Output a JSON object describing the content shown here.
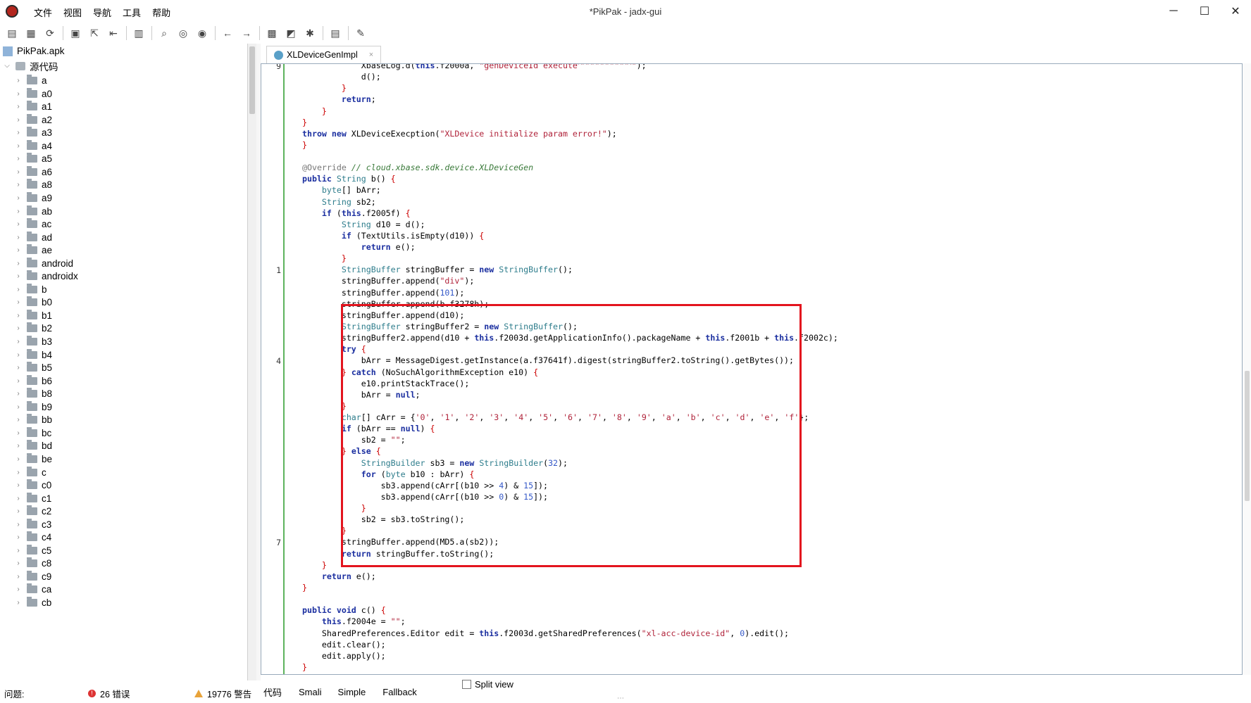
{
  "window": {
    "title": "*PikPak - jadx-gui",
    "menu": [
      "文件",
      "视图",
      "导航",
      "工具",
      "帮助"
    ],
    "controls": {
      "minimize": "─",
      "maximize": "☐",
      "close": "✕"
    }
  },
  "toolbar": {
    "icons": [
      "open-file-icon",
      "add-file-icon",
      "reload-icon",
      "save-icon",
      "export-icon",
      "sync-tree-icon",
      "flatten-icon",
      "search-icon",
      "search-class-icon",
      "search-usage-icon",
      "back-icon",
      "forward-icon",
      "quark-icon",
      "deobfuscation-icon",
      "debug-icon",
      "log-icon",
      "preferences-icon"
    ],
    "glyphs": [
      "▤",
      "▦",
      "⟳",
      "▣",
      "⇱",
      "⇤",
      "▥",
      "⌕",
      "◎",
      "◉",
      "←",
      "→",
      "▩",
      "◩",
      "✱",
      "▤",
      "✎"
    ]
  },
  "tree": {
    "root": "PikPak.apk",
    "source_node": "源代码",
    "packages": [
      "a",
      "a0",
      "a1",
      "a2",
      "a3",
      "a4",
      "a5",
      "a6",
      "a8",
      "a9",
      "ab",
      "ac",
      "ad",
      "ae",
      "android",
      "androidx",
      "b",
      "b0",
      "b1",
      "b2",
      "b3",
      "b4",
      "b5",
      "b6",
      "b8",
      "b9",
      "bb",
      "bc",
      "bd",
      "be",
      "c",
      "c0",
      "c1",
      "c2",
      "c3",
      "c4",
      "c5",
      "c8",
      "c9",
      "ca",
      "cb"
    ]
  },
  "editor": {
    "tab_label": "XLDeviceGenImpl",
    "tab_close": "×",
    "gutter_numbers": [
      {
        "line": 0,
        "text": "9"
      },
      {
        "line": 18,
        "text": "1"
      },
      {
        "line": 26,
        "text": "4"
      },
      {
        "line": 42,
        "text": "7"
      }
    ]
  },
  "view_tabs": [
    "代码",
    "Smali",
    "Simple",
    "Fallback"
  ],
  "split_view_label": "Split view",
  "status": {
    "issues_label": "问题:",
    "errors": "26 错误",
    "warnings": "19776 警告"
  },
  "colors": {
    "highlight_box": "#e3141e",
    "gutter_line": "#5db35d",
    "keyword": "#1b2fa0",
    "string": "#b0233a"
  }
}
